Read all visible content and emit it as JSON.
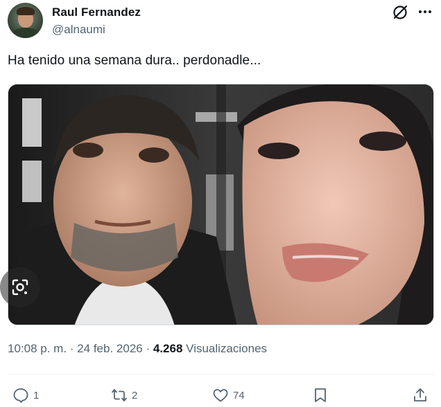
{
  "author": {
    "display_name": "Raul Fernandez",
    "handle": "@alnaumi"
  },
  "tweet": {
    "text": "Ha tenido una semana dura.. perdonadle..."
  },
  "meta": {
    "time": "10:08 p. m.",
    "separator": "·",
    "date": "24 feb. 2026",
    "views_count": "4.268",
    "views_label": "Visualizaciones"
  },
  "actions": {
    "replies": "1",
    "reposts": "2",
    "likes": "74"
  },
  "icons": {
    "header": [
      "grok-icon",
      "more-icon"
    ],
    "actions": [
      "reply-icon",
      "repost-icon",
      "like-icon",
      "bookmark-icon",
      "share-icon"
    ],
    "media": [
      "lens-search-icon"
    ]
  },
  "colors": {
    "text": "#0f1419",
    "secondary": "#536471",
    "divider": "#eff3f4"
  }
}
